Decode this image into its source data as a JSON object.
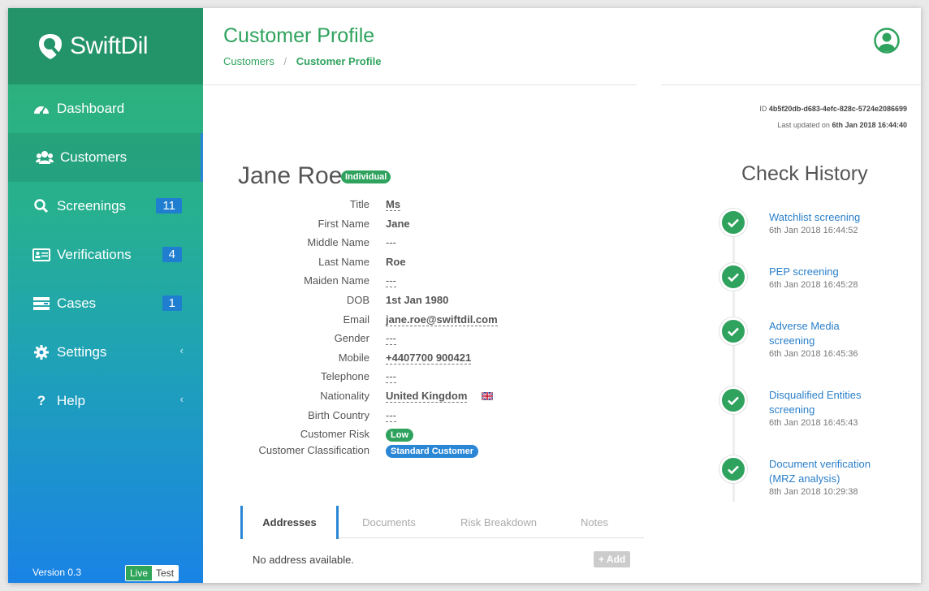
{
  "app": {
    "name": "SwiftDil",
    "version": "Version 0.3"
  },
  "sidebar": {
    "items": [
      {
        "label": "Dashboard",
        "icon": "dashboard-icon"
      },
      {
        "label": "Customers",
        "icon": "users-icon",
        "active": true
      },
      {
        "label": "Screenings",
        "icon": "search-icon",
        "badge": "11"
      },
      {
        "label": "Verifications",
        "icon": "id-card-icon",
        "badge": "4"
      },
      {
        "label": "Cases",
        "icon": "tasks-icon",
        "badge": "1"
      },
      {
        "label": "Settings",
        "icon": "gear-icon",
        "chevron": "‹"
      },
      {
        "label": "Help",
        "icon": "question-icon",
        "chevron": "‹"
      }
    ],
    "env_live": "Live",
    "env_test": "Test"
  },
  "header": {
    "title": "Customer Profile",
    "breadcrumb": {
      "parent": "Customers",
      "separator": "/",
      "current": "Customer Profile"
    }
  },
  "meta": {
    "id_label": "ID",
    "id_value": "4b5f20db-d683-4efc-828c-5724e2086699",
    "updated_label": "Last updated on",
    "updated_value": "6th Jan 2018 16:44:40"
  },
  "profile": {
    "name": "Jane Roe",
    "type": "Individual",
    "fields": [
      {
        "label": "Title",
        "value": "Ms"
      },
      {
        "label": "First Name",
        "value": "Jane"
      },
      {
        "label": "Middle Name",
        "value": "---"
      },
      {
        "label": "Last Name",
        "value": "Roe"
      },
      {
        "label": "Maiden Name",
        "value": "---"
      },
      {
        "label": "DOB",
        "value": "1st Jan 1980"
      },
      {
        "label": "Email",
        "value": "jane.roe@swiftdil.com"
      },
      {
        "label": "Gender",
        "value": "---"
      },
      {
        "label": "Mobile",
        "value": "+4407700 900421"
      },
      {
        "label": "Telephone",
        "value": "---"
      },
      {
        "label": "Nationality",
        "value": "United Kingdom"
      },
      {
        "label": "Birth Country",
        "value": "---"
      },
      {
        "label": "Customer Risk",
        "value": "Low"
      },
      {
        "label": "Customer Classification",
        "value": "Standard Customer"
      }
    ]
  },
  "tabs": [
    "Addresses",
    "Documents",
    "Risk Breakdown",
    "Notes"
  ],
  "addresses": {
    "empty": "No address available.",
    "add_label": "Add"
  },
  "check_history": {
    "title": "Check History",
    "items": [
      {
        "label": "Watchlist screening",
        "date": "6th Jan 2018 16:44:52"
      },
      {
        "label": "PEP screening",
        "date": "6th Jan 2018 16:45:28"
      },
      {
        "label": "Adverse Media screening",
        "date": "6th Jan 2018 16:45:36"
      },
      {
        "label": "Disqualified Entities screening",
        "date": "6th Jan 2018 16:45:43"
      },
      {
        "label": "Document verification (MRZ analysis)",
        "date": "8th Jan 2018 10:29:38"
      }
    ]
  },
  "colors": {
    "brand_green": "#2fa35e",
    "link_blue": "#2a7fc9",
    "badge_blue": "#1f7ed0"
  }
}
